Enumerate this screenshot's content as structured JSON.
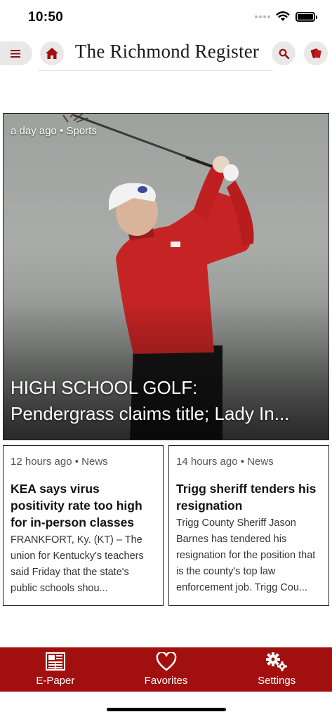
{
  "status_bar": {
    "time": "10:50"
  },
  "header": {
    "masthead": "The Richmond Register",
    "menu_icon": "hamburger-icon",
    "home_icon": "home-icon",
    "search_icon": "search-icon",
    "subscribe_icon": "ticket-icon"
  },
  "colors": {
    "brand": "#a10f0f",
    "button_bg": "#e8e8e8"
  },
  "hero": {
    "meta": "a day ago • Sports",
    "title_line1": "HIGH SCHOOL GOLF:",
    "title_line2": "Pendergrass claims title; Lady In..."
  },
  "cards": [
    {
      "meta": "12 hours ago • News",
      "title": "KEA says virus positivity rate too high for in-person classes",
      "body": "FRANKFORT, Ky. (KT) – The union for Kentucky's teachers said Friday that the state's public schools shou..."
    },
    {
      "meta": "14 hours ago • News",
      "title": "Trigg sheriff tenders his resignation",
      "body": "Trigg County Sheriff Jason Barnes has tendered his resignation for the position that is the county's top law enforcement job. Trigg Cou..."
    }
  ],
  "bottom_nav": [
    {
      "label": "E-Paper",
      "icon": "newspaper-icon"
    },
    {
      "label": "Favorites",
      "icon": "heart-icon"
    },
    {
      "label": "Settings",
      "icon": "gears-icon"
    }
  ]
}
